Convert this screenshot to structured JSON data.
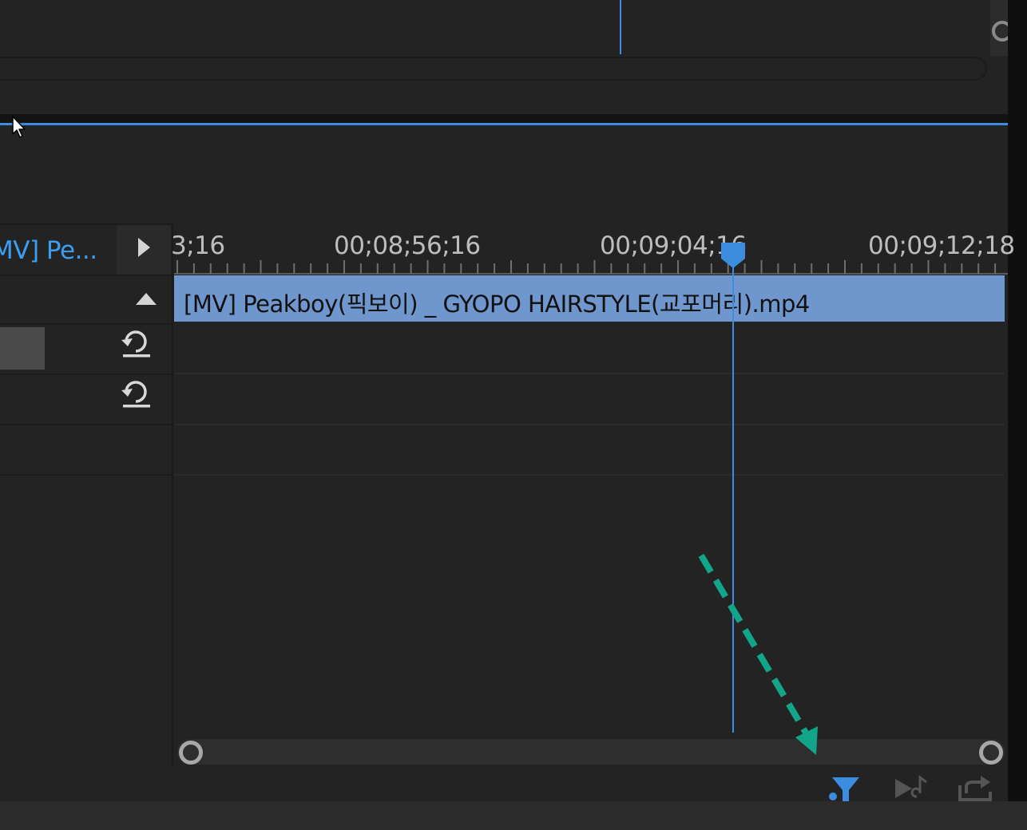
{
  "colors": {
    "accent": "#3c8ce0",
    "clip": "#6f96cd",
    "background": "#232323",
    "annotation": "#13a589"
  },
  "effect_controls": {
    "clip_name": "MV] Pe...",
    "expand_icon": "triangle-right-icon",
    "collapse_icon": "triangle-up-icon",
    "reset_icon": "reset-icon"
  },
  "timeline": {
    "ticks": [
      "3;16",
      "00;08;56;16",
      "00;09;04;16",
      "00;09;12;18"
    ],
    "clip_label": "[MV] Peakboy(픽보이) _ GYOPO HAIRSTYLE(교포머리).mp4"
  },
  "toolbar": {
    "icons": [
      "filter-icon",
      "play-audio-icon",
      "export-icon"
    ]
  }
}
